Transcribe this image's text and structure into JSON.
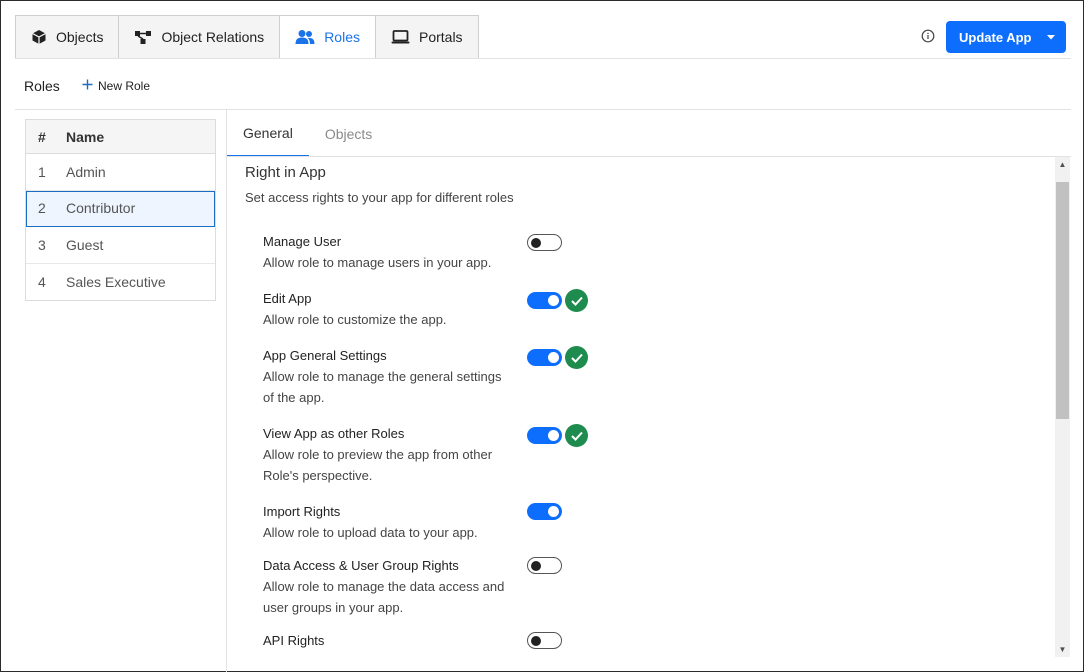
{
  "top_tabs": [
    {
      "label": "Objects",
      "icon": "cube-icon"
    },
    {
      "label": "Object Relations",
      "icon": "relations-icon"
    },
    {
      "label": "Roles",
      "icon": "users-icon",
      "active": true
    },
    {
      "label": "Portals",
      "icon": "laptop-icon"
    }
  ],
  "header": {
    "update_button": "Update App"
  },
  "roles_bar": {
    "title": "Roles",
    "new_role": "New Role"
  },
  "role_table": {
    "columns": [
      "#",
      "Name"
    ],
    "rows": [
      {
        "num": "1",
        "name": "Admin"
      },
      {
        "num": "2",
        "name": "Contributor",
        "selected": true
      },
      {
        "num": "3",
        "name": "Guest"
      },
      {
        "num": "4",
        "name": "Sales Executive"
      }
    ]
  },
  "detail_tabs": [
    {
      "label": "General",
      "active": true
    },
    {
      "label": "Objects"
    }
  ],
  "section": {
    "title": "Right in App",
    "description": "Set access rights to your app for different roles"
  },
  "permissions": [
    {
      "title": "Manage User",
      "desc": "Allow role to manage users in your app.",
      "enabled": false,
      "changed": false
    },
    {
      "title": "Edit App",
      "desc": "Allow role to customize the app.",
      "enabled": true,
      "changed": true
    },
    {
      "title": "App General Settings",
      "desc": "Allow role to manage the general settings of the app.",
      "enabled": true,
      "changed": true
    },
    {
      "title": "View App as other Roles",
      "desc": "Allow role to preview the app from other Role's perspective.",
      "enabled": true,
      "changed": true
    },
    {
      "title": "Import Rights",
      "desc": "Allow role to upload data to your app.",
      "enabled": true,
      "changed": false
    },
    {
      "title": "Data Access & User Group Rights",
      "desc": "Allow role to manage the data access and user groups in your app.",
      "enabled": false,
      "changed": false
    },
    {
      "title": "API Rights",
      "desc": "",
      "enabled": false,
      "changed": false
    }
  ],
  "colors": {
    "accent": "#0d6efd",
    "check": "#1e8c4e",
    "selected_border": "#1a6dc2"
  }
}
